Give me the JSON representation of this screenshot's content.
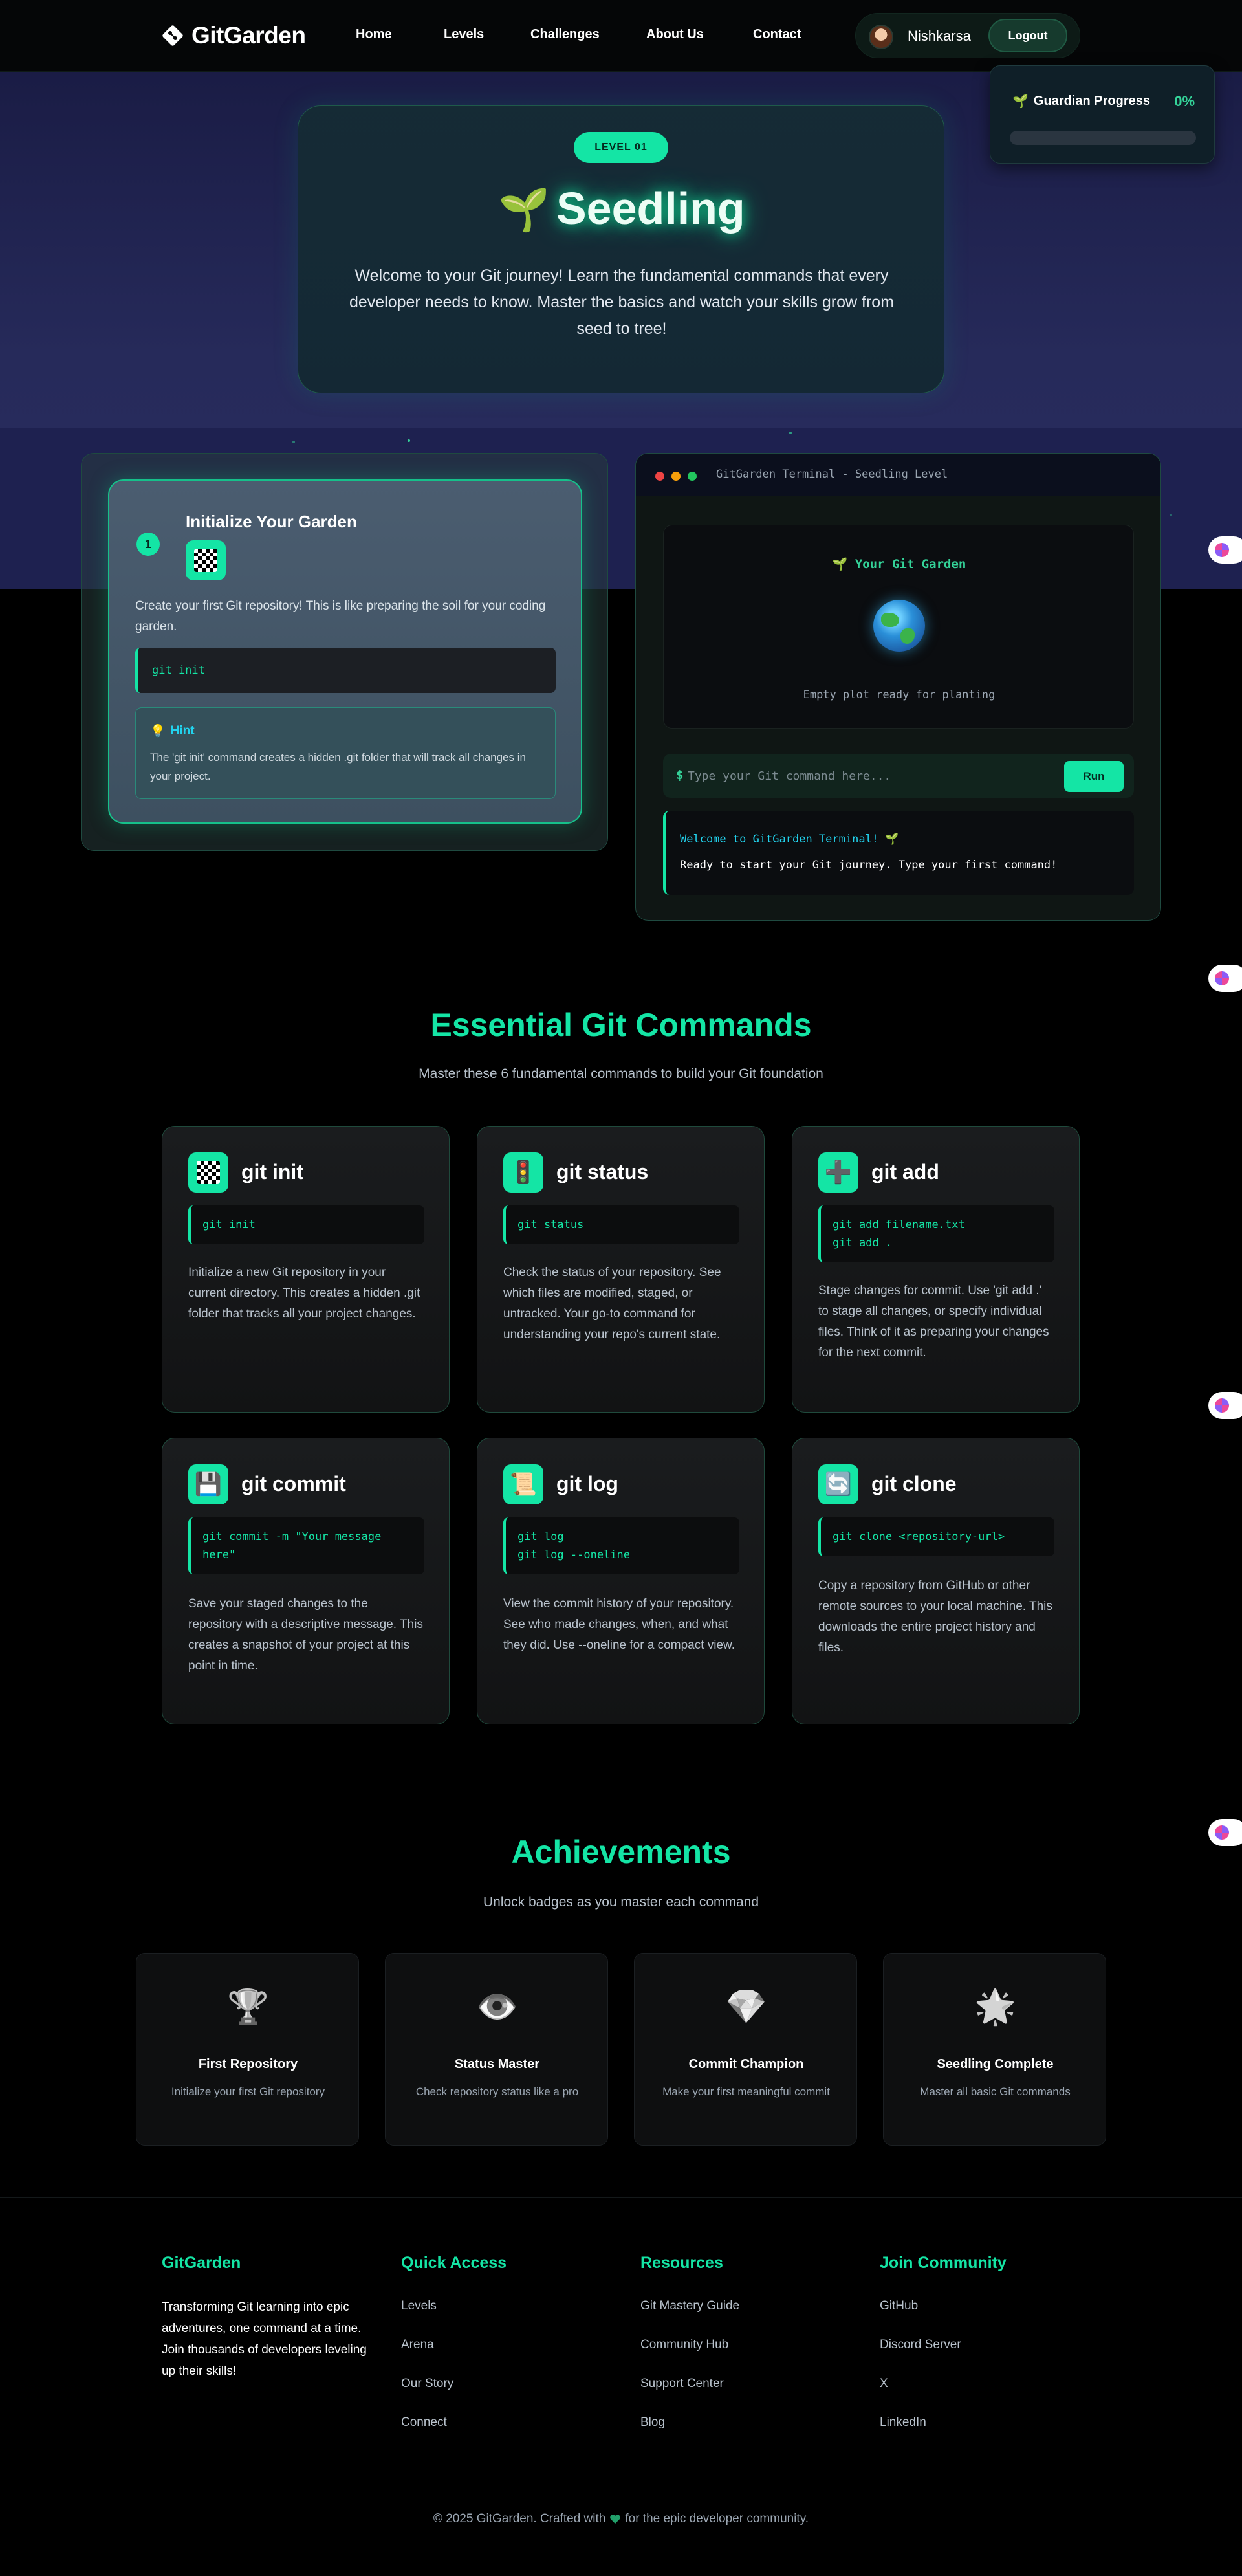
{
  "nav": {
    "brand": "GitGarden",
    "links": [
      "Home",
      "Levels",
      "Challenges",
      "About Us",
      "Contact"
    ],
    "user_name": "Nishkarsa",
    "logout_label": "Logout"
  },
  "guardian": {
    "title": "Guardian Progress",
    "percent_label": "0%",
    "progress": 0
  },
  "hero": {
    "badge": "LEVEL 01",
    "title_icon": "🌱",
    "title": "Seedling",
    "description": "Welcome to your Git journey! Learn the fundamental commands that every developer needs to know. Master the basics and watch your skills grow from seed to tree!"
  },
  "task": {
    "step": "1",
    "title": "Initialize Your Garden",
    "icon": "checkered-flag-icon",
    "description": "Create your first Git repository! This is like preparing the soil for your coding garden.",
    "code": "git init",
    "hint_icon": "💡",
    "hint_title": "Hint",
    "hint_text": "The 'git init' command creates a hidden .git folder that will track all changes in your project."
  },
  "terminal": {
    "title": "GitGarden Terminal - Seedling Level",
    "garden_title": "🌱 Your Git Garden",
    "garden_empty": "Empty plot ready for planting",
    "prompt": "$",
    "input_placeholder": "Type your Git command here...",
    "run_label": "Run",
    "output_line1": "Welcome to GitGarden Terminal! 🌱",
    "output_line2": "Ready to start your Git journey. Type your first command!"
  },
  "commands_section": {
    "title": "Essential Git Commands",
    "subtitle": "Master these 6 fundamental commands to build your Git foundation",
    "cards": [
      {
        "name": "git init",
        "icon": "🏁",
        "code": "git init",
        "desc": "Initialize a new Git repository in your current directory. This creates a hidden .git folder that tracks all your project changes."
      },
      {
        "name": "git status",
        "icon": "🚦",
        "code": "git status",
        "desc": "Check the status of your repository. See which files are modified, staged, or untracked. Your go-to command for understanding your repo's current state."
      },
      {
        "name": "git add",
        "icon": "➕",
        "code": "git add filename.txt\ngit add .",
        "desc": "Stage changes for commit. Use 'git add .' to stage all changes, or specify individual files. Think of it as preparing your changes for the next commit."
      },
      {
        "name": "git commit",
        "icon": "💾",
        "code": "git commit -m \"Your message here\"",
        "desc": "Save your staged changes to the repository with a descriptive message. This creates a snapshot of your project at this point in time."
      },
      {
        "name": "git log",
        "icon": "📜",
        "code": "git log\ngit log --oneline",
        "desc": "View the commit history of your repository. See who made changes, when, and what they did. Use --oneline for a compact view."
      },
      {
        "name": "git clone",
        "icon": "🔄",
        "code": "git clone <repository-url>",
        "desc": "Copy a repository from GitHub or other remote sources to your local machine. This downloads the entire project history and files."
      }
    ]
  },
  "achievements": {
    "title": "Achievements",
    "subtitle": "Unlock badges as you master each command",
    "items": [
      {
        "icon": "🏆",
        "title": "First Repository",
        "desc": "Initialize your first Git repository"
      },
      {
        "icon": "👁️",
        "title": "Status Master",
        "desc": "Check repository status like a pro"
      },
      {
        "icon": "💎",
        "title": "Commit Champion",
        "desc": "Make your first meaningful commit"
      },
      {
        "icon": "🌟",
        "title": "Seedling Complete",
        "desc": "Master all basic Git commands"
      }
    ]
  },
  "footer": {
    "brand": "GitGarden",
    "tagline": "Transforming Git learning into epic adventures, one command at a time. Join thousands of developers leveling up their skills!",
    "quick_title": "Quick Access",
    "quick_links": [
      "Levels",
      "Arena",
      "Our Story",
      "Connect"
    ],
    "resources_title": "Resources",
    "resources_links": [
      "Git Mastery Guide",
      "Community Hub",
      "Support Center",
      "Blog"
    ],
    "community_title": "Join Community",
    "community_links": [
      "GitHub",
      "Discord Server",
      "X",
      "LinkedIn"
    ],
    "copy_before": "© 2025 GitGarden. Crafted with",
    "copy_after": "for the epic developer community."
  },
  "colors": {
    "accent": "#14e5a5",
    "hero_bg": "#262a5a",
    "terminal_cyan": "#22d3ee"
  }
}
